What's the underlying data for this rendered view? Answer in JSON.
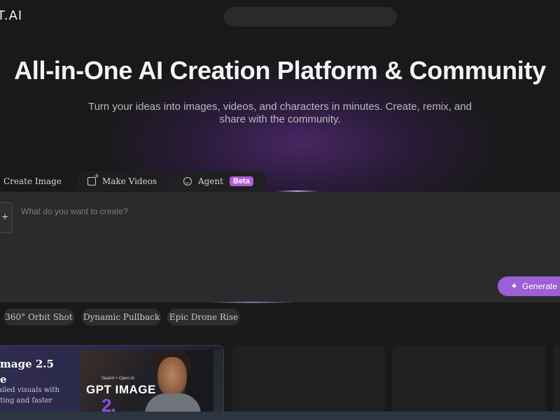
{
  "header": {
    "logo_text": "T.AI"
  },
  "hero": {
    "title": "All-in-One AI Creation Platform & Community",
    "subtitle": "Turn your ideas into images, videos, and characters in minutes. Create, remix, and share with the community."
  },
  "tabs": [
    {
      "label": "Create Image",
      "icon": "image-icon"
    },
    {
      "label": "Make Videos",
      "icon": "video-plus-icon"
    },
    {
      "label": "Agent",
      "icon": "agent-smile-icon",
      "badge": "Beta"
    }
  ],
  "prompt": {
    "placeholder": "What do you want to create?",
    "add_label": "+",
    "generate_label": "Generate",
    "generate_icon": "sparkle-icon"
  },
  "chips": [
    "360° Orbit Shot",
    "Dynamic Pullback",
    "Epic Drone Rise"
  ],
  "featured_card": {
    "title": "mage 2.5\ne",
    "description": "ailed visuals with\niting and faster\n.",
    "thumb_brand": "SeaArt × Open AI",
    "thumb_title": "GPT IMAGE",
    "thumb_version": "2."
  },
  "colors": {
    "background": "#19191a",
    "accent": "#9b5fd6",
    "beta_badge": "#b45ad9"
  }
}
